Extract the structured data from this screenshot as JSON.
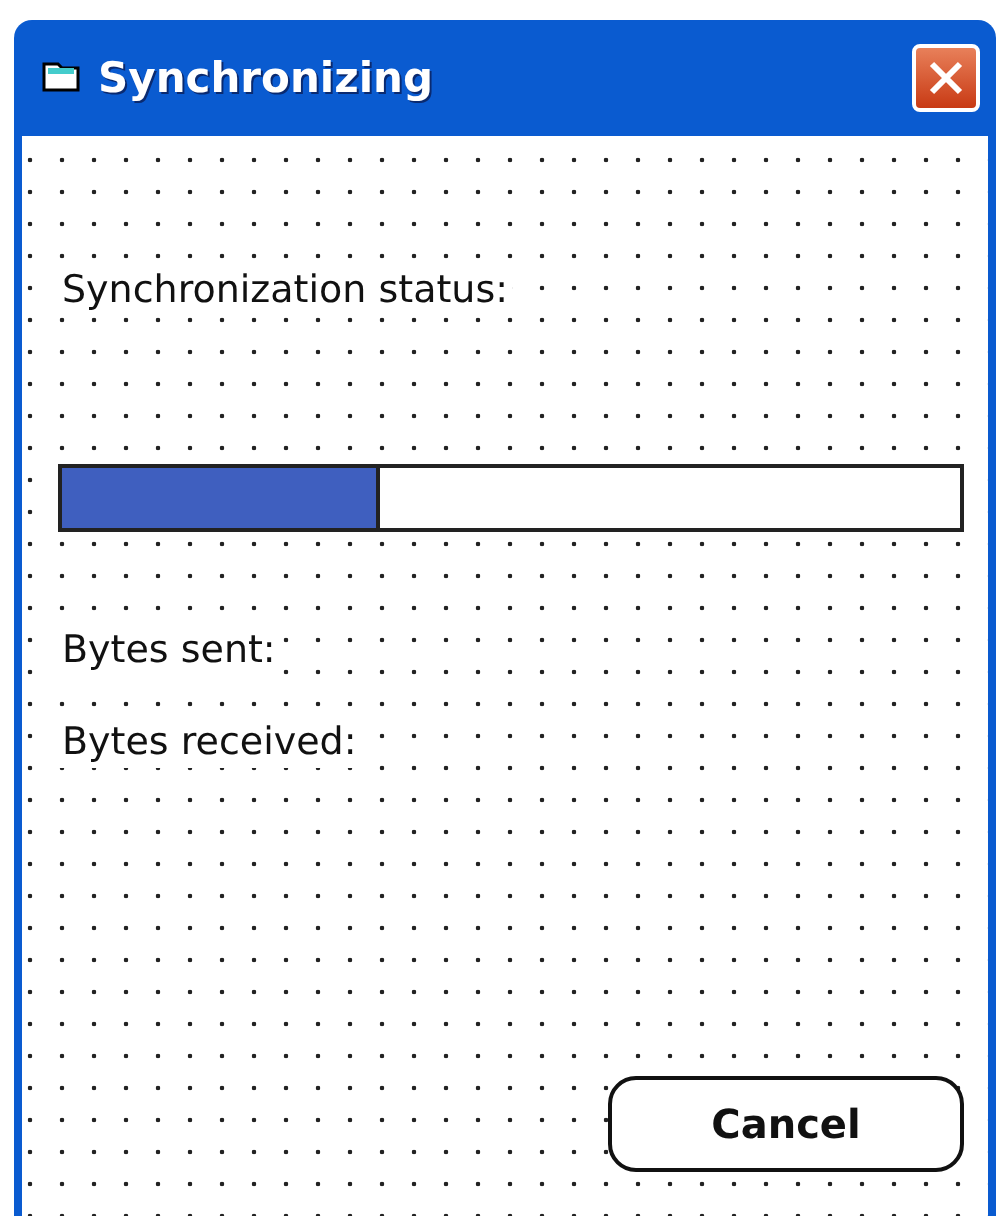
{
  "window": {
    "title": "Synchronizing"
  },
  "status_label": "Synchronization status:",
  "progress": {
    "level": 0.355
  },
  "bytes_sent_label": "Bytes sent:",
  "bytes_received_label": "Bytes received:",
  "buttons": [
    {
      "label": "Cancel"
    }
  ]
}
